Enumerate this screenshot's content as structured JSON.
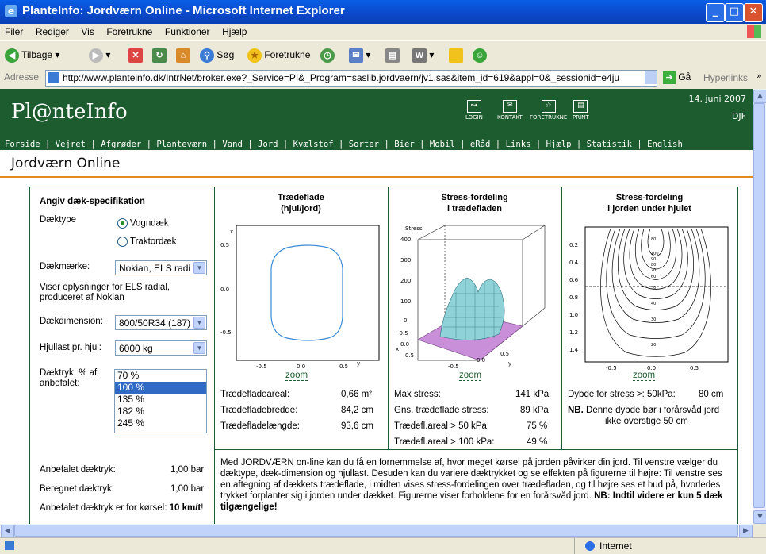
{
  "window": {
    "title": "PlanteInfo: Jordværn Online - Microsoft Internet Explorer",
    "ie_glyph": "e"
  },
  "menu": [
    "Filer",
    "Rediger",
    "Vis",
    "Foretrukne",
    "Funktioner",
    "Hjælp"
  ],
  "toolbar": {
    "back": "Tilbage",
    "search": "Søg",
    "favorites": "Foretrukne"
  },
  "address": {
    "label": "Adresse",
    "url": "http://www.planteinfo.dk/IntrNet/broker.exe?_Service=PI&_Program=saslib.jordvaern/jv1.sas&item_id=619&appl=0&_sessionid=e4ju",
    "go": "Gå",
    "hyperlinks": "Hyperlinks"
  },
  "site": {
    "logo": "Pl@nteInfo",
    "icons": [
      {
        "name": "login",
        "label": "LOGIN",
        "glyph": "⊶"
      },
      {
        "name": "kontakt",
        "label": "KONTAKT",
        "glyph": "✉"
      },
      {
        "name": "foretrukne",
        "label": "FORETRUKNE",
        "glyph": "☆"
      },
      {
        "name": "print",
        "label": "PRINT",
        "glyph": "▤"
      }
    ],
    "date": "14. juni 2007",
    "org": "DJF",
    "nav": [
      "Forside",
      "Vejret",
      "Afgrøder",
      "Planteværn",
      "Vand",
      "Jord",
      "Kvælstof",
      "Sorter",
      "Bier",
      "Mobil",
      "eRåd",
      "Links",
      "Hjælp",
      "Statistik",
      "English"
    ],
    "page_title": "Jordværn Online"
  },
  "spec": {
    "heading": "Angiv dæk-specifikation",
    "daektype_label": "Dæktype",
    "radio1": "Vogndæk",
    "radio2": "Traktordæk",
    "maerke_label": "Dækmærke:",
    "maerke_value": "Nokian, ELS radi",
    "info": [
      "Viser oplysninger for ELS radial,",
      "produceret af Nokian"
    ],
    "dimension_label": "Dækdimension:",
    "dimension_value": "800/50R34 (187)",
    "hjullast_label": "Hjullast pr. hjul:",
    "hjullast_value": "6000 kg",
    "tryk_label": [
      "Dæktryk, % af",
      "anbefalet:"
    ],
    "tryk_options": [
      "70 %",
      "100 %",
      "135 %",
      "182 %",
      "245 %"
    ],
    "anbefalet_label": "Anbefalet dæktryk:",
    "anbefalet_value": "1,00 bar",
    "beregnet_label": "Beregnet dæktryk:",
    "beregnet_value": "1,00 bar",
    "korsel_text": "Anbefalet dæktryk er for kørsel:",
    "korsel_value": "10 km/t",
    "korsel_end": "!"
  },
  "chart1": {
    "title": [
      "Trædeflade",
      "(hjul/jord)"
    ],
    "ylabel": "x",
    "xlabel": "y",
    "yticks": [
      "0.5",
      "0.0",
      "-0.5"
    ],
    "xticks": [
      "-0.5",
      "0.0",
      "0.5"
    ],
    "zoom": "zoom",
    "stats": [
      [
        "Trædefladeareal:",
        "0,66 m²"
      ],
      [
        "Trædefladebredde:",
        "84,2 cm"
      ],
      [
        "Trædefladelængde:",
        "93,6 cm"
      ]
    ]
  },
  "chart2": {
    "title": [
      "Stress-fordeling",
      "i trædefladen"
    ],
    "zlabel": "Stress",
    "zticks": [
      "400",
      "300",
      "200",
      "100",
      "0"
    ],
    "xlabel": "x",
    "ylabel": "y",
    "xticks": [
      "-0.5",
      "0.0",
      "0.5"
    ],
    "yticks": [
      "-0.5",
      "0.0",
      "0.5"
    ],
    "zoom": "zoom",
    "stats": [
      [
        "Max stress:",
        "141 kPa"
      ],
      [
        "Gns. trædeflade stress:",
        "89 kPa"
      ],
      [
        "Trædefl.areal  > 50 kPa:",
        "75 %"
      ],
      [
        "Trædefl.areal > 100 kPa:",
        "49 %"
      ]
    ]
  },
  "chart3": {
    "title": [
      "Stress-fordeling",
      "i jorden under hjulet"
    ],
    "yticks": [
      "0.2",
      "0.4",
      "0.6",
      "0.8",
      "1.0",
      "1.2",
      "1.4"
    ],
    "xticks": [
      "-0.5",
      "0.0",
      "0.5"
    ],
    "contour_labels": [
      "80",
      "100",
      "90",
      "80",
      "70",
      "60",
      "50",
      "40",
      "30",
      "20"
    ],
    "zoom": "zoom",
    "depth_label": "Dybde for stress >: 50kPa:",
    "depth_value": "80 cm",
    "note_bold": "NB.",
    "note": [
      "Denne dybde bør i forårsvåd jord",
      "ikke overstige 50 cm"
    ]
  },
  "description": {
    "text": "Med JORDVÆRN on-line kan du få en fornemmelse af, hvor meget kørsel på jorden påvirker din jord. Til venstre vælger du dæktype, dæk-dimension og hjullast. Desuden kan du variere dæktrykket og se effekten på figurerne til højre: Til venstre ses en aftegning af dækkets trædeflade, i midten vises stress-fordelingen over trædefladen, og til højre ses et bud på, hvorledes trykket forplanter sig i jorden under dækket. Figurerne viser forholdene for en forårsvåd jord.",
    "bold": "NB: Indtil videre er kun 5 dæk tilgængelige!"
  },
  "status": {
    "zone": "Internet"
  }
}
